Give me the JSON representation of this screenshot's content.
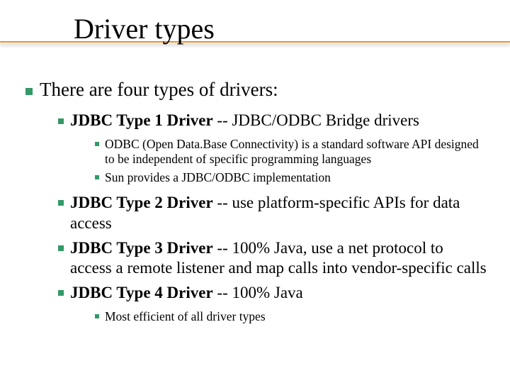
{
  "title": "Driver types",
  "lvl1": "There are four types of drivers:",
  "type1": {
    "bold": "JDBC Type 1 Driver",
    "rest": " -- JDBC/ODBC Bridge drivers"
  },
  "type1_sub": [
    "ODBC (Open Data.Base Connectivity) is a standard software API designed to be independent of specific programming languages",
    "Sun provides a JDBC/ODBC implementation"
  ],
  "type2": {
    "bold": "JDBC Type 2 Driver",
    "rest": " -- use platform-specific APIs for data access"
  },
  "type3": {
    "bold": "JDBC Type 3 Driver",
    "rest": " -- 100% Java, use a net protocol to access a remote listener and map calls into vendor-specific calls"
  },
  "type4": {
    "bold": "JDBC Type 4 Driver",
    "rest": " -- 100% Java"
  },
  "type4_sub": "Most efficient of all driver types"
}
